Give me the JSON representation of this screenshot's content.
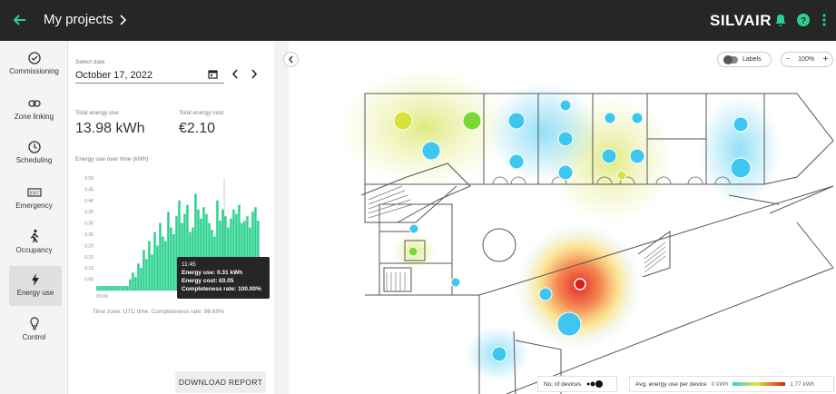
{
  "topbar": {
    "breadcrumb": "My projects",
    "brand": "SILVAIR"
  },
  "sidebar": {
    "items": [
      {
        "label": "Commissioning",
        "icon": "check-circle-icon"
      },
      {
        "label": "Zone linking",
        "icon": "link-icon"
      },
      {
        "label": "Scheduling",
        "icon": "clock-icon"
      },
      {
        "label": "Emergency",
        "icon": "exit-sign-icon"
      },
      {
        "label": "Occupancy",
        "icon": "walking-person-icon"
      },
      {
        "label": "Energy use",
        "icon": "lightning-icon",
        "active": true
      },
      {
        "label": "Control",
        "icon": "lightbulb-icon"
      }
    ]
  },
  "panel": {
    "select_date_label": "Select date",
    "date_value": "October 17, 2022",
    "total_energy_label": "Total energy use",
    "total_energy_value": "13.98 kWh",
    "total_cost_label": "Total energy cost",
    "total_cost_value": "€2.10",
    "chart_title": "Energy use over time (kWh)",
    "tooltip": {
      "time": "11:45",
      "energy": "Energy use: 0.31 kWh",
      "cost": "Energy cost: €0.05",
      "completeness": "Completeness rate: 100.00%"
    },
    "timezone_note": "Time zone: UTC time. Completeness rate: 98.69%",
    "download_label": "DOWNLOAD REPORT"
  },
  "chart_data": {
    "type": "bar",
    "title": "Energy use over time (kWh)",
    "y_ticks": [
      "0.50",
      "0.45",
      "0.40",
      "0.35",
      "0.30",
      "0.25",
      "0.20",
      "0.15",
      "0.10",
      "0.05"
    ],
    "x_tick_label": "00:00",
    "ylim": [
      0,
      0.5
    ],
    "values": [
      0.02,
      0.02,
      0.02,
      0.02,
      0.02,
      0.02,
      0.02,
      0.02,
      0.02,
      0.02,
      0.02,
      0.02,
      0.05,
      0.08,
      0.06,
      0.12,
      0.1,
      0.18,
      0.14,
      0.22,
      0.16,
      0.26,
      0.2,
      0.3,
      0.24,
      0.22,
      0.35,
      0.28,
      0.25,
      0.33,
      0.4,
      0.3,
      0.34,
      0.38,
      0.26,
      0.28,
      0.43,
      0.36,
      0.32,
      0.37,
      0.34,
      0.3,
      0.27,
      0.24,
      0.4,
      0.31,
      0.36,
      0.33,
      0.28,
      0.32,
      0.36,
      0.34,
      0.38,
      0.3,
      0.31,
      0.33,
      0.28,
      0.35,
      0.37,
      0.31
    ],
    "color": "#2bd18f"
  },
  "map": {
    "labels_toggle": "Labels",
    "zoom_level": "100%",
    "zoom_out": "−",
    "zoom_in": "+",
    "legend_devices": "No. of devices",
    "legend_energy": "Avg. energy use per device",
    "legend_min": "0 kWh",
    "legend_max": "1.77 kWh"
  },
  "colors": {
    "accent": "#2bd18f",
    "topbar": "#262626",
    "hot": "#e53030",
    "cool": "#3dc6f0"
  }
}
